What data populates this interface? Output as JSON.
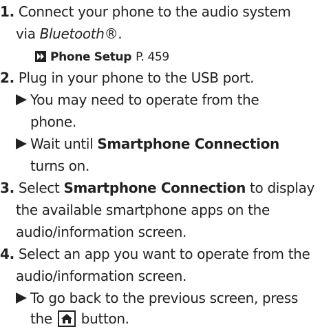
{
  "steps": [
    {
      "number": "1.",
      "lines": [
        {
          "text": "Connect your phone to the audio system"
        },
        {
          "pre": "via ",
          "italic": "Bluetooth",
          "post": "®."
        }
      ],
      "reference": {
        "bold": "Phone Setup",
        "page": "P. 459"
      }
    },
    {
      "number": "2.",
      "lines": [
        {
          "text": "Plug in your phone to the USB port."
        }
      ],
      "notes": [
        {
          "line1": "You may need to operate from the",
          "line2": "phone."
        },
        {
          "pre": "Wait until ",
          "bold": "Smartphone Connection",
          "line2": "turns on."
        }
      ]
    },
    {
      "number": "3.",
      "lines": [
        {
          "pre": "Select ",
          "bold": "Smartphone Connection",
          "post": " to display"
        },
        {
          "text": "the available smartphone apps on the"
        },
        {
          "text": "audio/information screen."
        }
      ]
    },
    {
      "number": "4.",
      "lines": [
        {
          "text": "Select an app you want to operate from the"
        },
        {
          "text": "audio/information screen."
        }
      ],
      "notes": [
        {
          "line1": "To go back to the previous screen, press",
          "pre2": "the ",
          "post2": " button."
        }
      ]
    }
  ],
  "icons": {
    "reference_arrow": "reference-arrow-icon",
    "note_marker": "triangle-bullet-icon",
    "home_button": "home-icon"
  }
}
